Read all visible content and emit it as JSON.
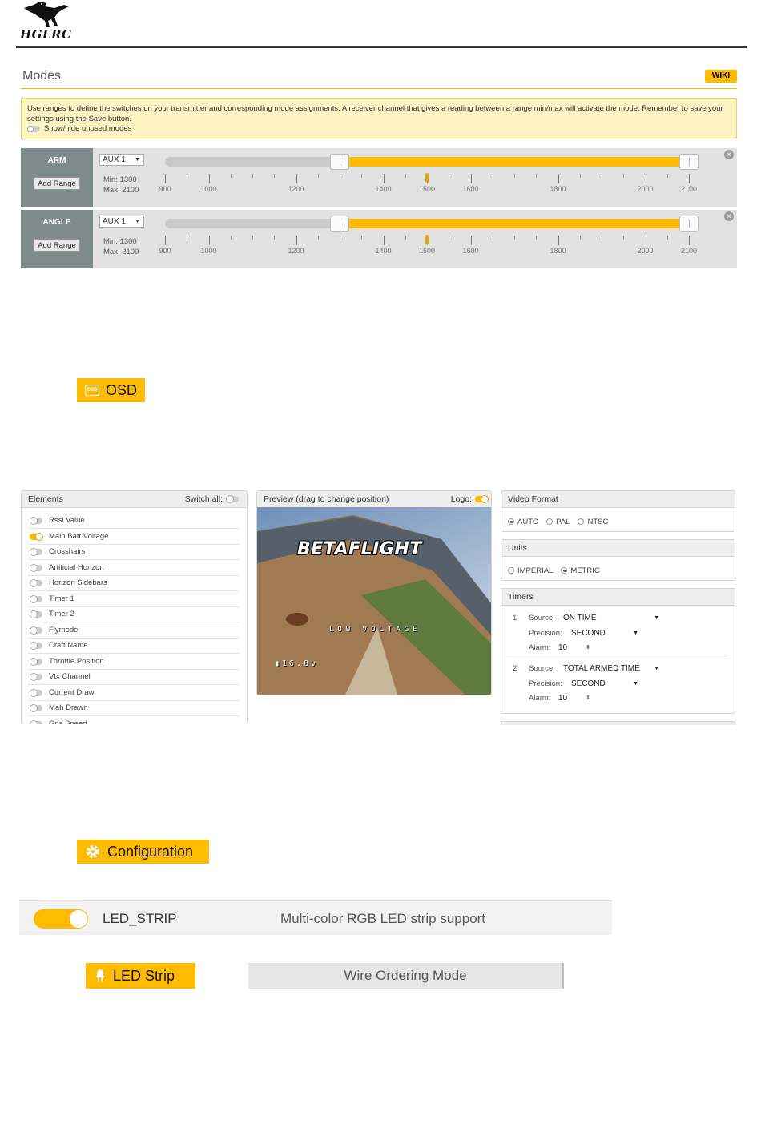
{
  "header": {
    "logo_text": "HGLRC"
  },
  "modes": {
    "title": "Modes",
    "wiki_label": "WIKI",
    "info_text": "Use ranges to define the switches on your transmitter and corresponding mode assignments. A receiver channel that gives a reading between a range min/max will activate the mode. Remember to save your settings using the Save button.",
    "toggle_label": "Show/hide unused modes",
    "rows": [
      {
        "name": "ARM",
        "add_range": "Add Range",
        "channel": "AUX 1",
        "min": "Min: 1300",
        "max": "Max: 2100"
      },
      {
        "name": "ANGLE",
        "add_range": "Add Range",
        "channel": "AUX 1",
        "min": "Min: 1300",
        "max": "Max: 2100"
      }
    ],
    "range": {
      "scale_min": 900,
      "scale_max": 2100,
      "min": 1300,
      "max": 2100,
      "current": 1500
    },
    "tick_labels": [
      "900",
      "1000",
      "1200",
      "1400",
      "1500",
      "1600",
      "1800",
      "2000",
      "2100"
    ]
  },
  "osd_tab": {
    "label": "OSD",
    "icon": "osd-icon"
  },
  "osd": {
    "elements_title": "Elements",
    "switch_all": "Switch all:",
    "elements": [
      {
        "label": "Rssi Value",
        "on": false
      },
      {
        "label": "Main Batt Voltage",
        "on": true
      },
      {
        "label": "Crosshairs",
        "on": false
      },
      {
        "label": "Artificial Horizon",
        "on": false
      },
      {
        "label": "Horizon Sidebars",
        "on": false
      },
      {
        "label": "Timer 1",
        "on": false
      },
      {
        "label": "Timer 2",
        "on": false
      },
      {
        "label": "Flymode",
        "on": false
      },
      {
        "label": "Craft Name",
        "on": false
      },
      {
        "label": "Throttle Position",
        "on": false
      },
      {
        "label": "Vtx Channel",
        "on": false
      },
      {
        "label": "Current Draw",
        "on": false
      },
      {
        "label": "Mah Drawn",
        "on": false
      },
      {
        "label": "Gps Speed",
        "on": false
      }
    ],
    "preview_title": "Preview (drag to change position)",
    "logo_label": "Logo:",
    "preview_brand": "BETAFLIGHT",
    "preview_warning": "LOW VOLTAGE",
    "preview_voltage": "16.8v",
    "video_format": {
      "title": "Video Format",
      "options": [
        "AUTO",
        "PAL",
        "NTSC"
      ],
      "selected": "AUTO"
    },
    "units": {
      "title": "Units",
      "options": [
        "IMPERIAL",
        "METRIC"
      ],
      "selected": "METRIC"
    },
    "timers": {
      "title": "Timers",
      "source_label": "Source:",
      "precision_label": "Precision:",
      "alarm_label": "Alarm:",
      "items": [
        {
          "num": "1",
          "source": "ON TIME",
          "precision": "SECOND",
          "alarm": "10"
        },
        {
          "num": "2",
          "source": "TOTAL ARMED TIME",
          "precision": "SECOND",
          "alarm": "10"
        }
      ]
    }
  },
  "config_tab": {
    "label": "Configuration",
    "icon": "gear-icon"
  },
  "feature": {
    "name": "LED_STRIP",
    "description": "Multi-color RGB LED strip support",
    "enabled": true
  },
  "led_tab": {
    "label": "LED Strip",
    "icon": "led-icon"
  },
  "wire_mode": {
    "label": "Wire Ordering Mode"
  },
  "colors": {
    "accent": "#ffbb00",
    "mode_label_bg": "#7f8a8a",
    "range_bg": "#e2e2e2"
  }
}
